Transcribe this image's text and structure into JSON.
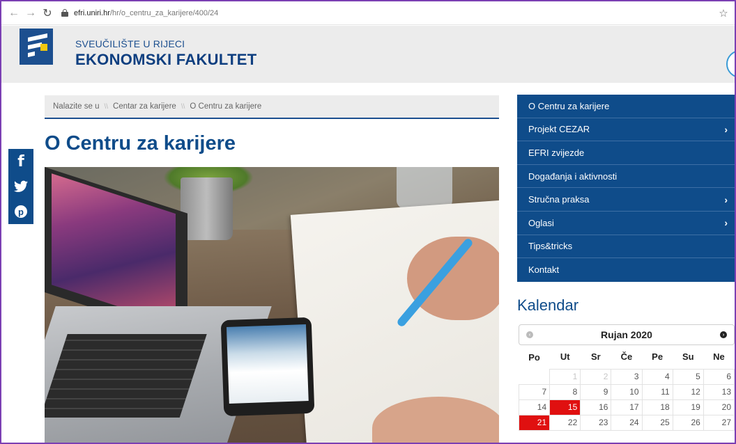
{
  "browser": {
    "url_host": "efri.uniri.hr",
    "url_path": "/hr/o_centru_za_karijere/400/24"
  },
  "header": {
    "university": "SVEUČILIŠTE U RIJECI",
    "faculty": "EKONOMSKI FAKULTET"
  },
  "social": [
    "facebook-icon",
    "twitter-icon",
    "pinterest-icon"
  ],
  "breadcrumb": {
    "label": "Nalazite se u",
    "items": [
      "Centar za karijere",
      "O Centru za karijere"
    ]
  },
  "page": {
    "title": "O Centru za karijere"
  },
  "sidebar": {
    "items": [
      {
        "label": "O Centru za karijere",
        "has_children": false
      },
      {
        "label": "Projekt CEZAR",
        "has_children": true
      },
      {
        "label": "EFRI zvijezde",
        "has_children": false
      },
      {
        "label": "Događanja i aktivnosti",
        "has_children": false
      },
      {
        "label": "Stručna praksa",
        "has_children": true
      },
      {
        "label": "Oglasi",
        "has_children": true
      },
      {
        "label": "Tips&tricks",
        "has_children": false
      },
      {
        "label": "Kontakt",
        "has_children": false
      }
    ]
  },
  "calendar": {
    "title": "Kalendar",
    "month": "Rujan 2020",
    "weekdays": [
      "Po",
      "Ut",
      "Sr",
      "Če",
      "Pe",
      "Su",
      "Ne"
    ],
    "rows": [
      [
        "",
        "1",
        "2",
        "3",
        "4",
        "5",
        "6"
      ],
      [
        "7",
        "8",
        "9",
        "10",
        "11",
        "12",
        "13"
      ],
      [
        "14",
        "15",
        "16",
        "17",
        "18",
        "19",
        "20"
      ],
      [
        "21",
        "22",
        "23",
        "24",
        "25",
        "26",
        "27"
      ]
    ],
    "highlighted": [
      "15",
      "21"
    ],
    "muted": [
      "1",
      "2"
    ],
    "highlight_color": "#e01010"
  },
  "colors": {
    "brand_blue": "#0f4c8a",
    "header_bg": "#ececec"
  }
}
